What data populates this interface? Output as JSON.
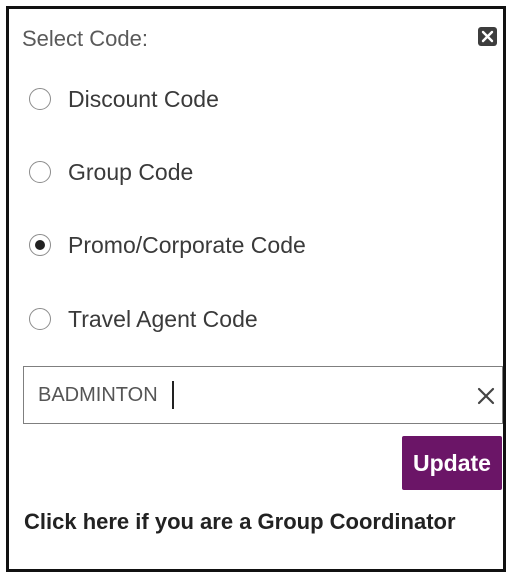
{
  "dialog": {
    "title": "Select Code:",
    "close_icon": "close-square-icon"
  },
  "options": [
    {
      "label": "Discount Code",
      "selected": false
    },
    {
      "label": "Group Code",
      "selected": false
    },
    {
      "label": "Promo/Corporate Code",
      "selected": true
    },
    {
      "label": "Travel Agent Code",
      "selected": false
    }
  ],
  "code_input": {
    "value": "BADMINTON",
    "clear_icon": "clear-x-icon"
  },
  "update_button": {
    "label": "Update",
    "color": "#6b1567"
  },
  "group_coordinator_link": {
    "text": "Click here if you are a Group Coordinator"
  }
}
